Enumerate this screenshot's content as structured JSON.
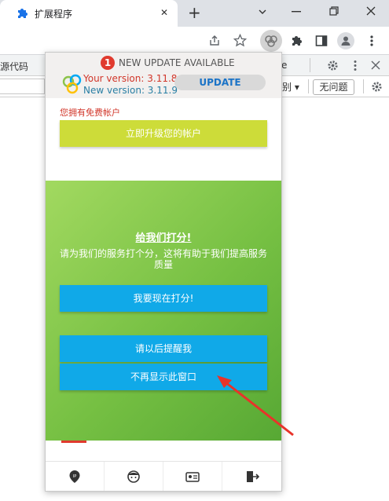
{
  "browser": {
    "tab_title": "扩展程序",
    "new_tab_symbol": "+",
    "close_symbol": "✕"
  },
  "devtools": {
    "source_label": "源代码",
    "partial_e": "e",
    "partial_filter": "别 ▾",
    "no_issues": "无问题"
  },
  "popup": {
    "badge_count": "1",
    "update_title": "NEW UPDATE AVAILABLE",
    "your_version": "Your version: 3.11.8",
    "new_version": "New version: 3.11.9",
    "update_button": "UPDATE",
    "free_account_text": "您拥有免费帐户",
    "upgrade_button": "立即升级您的帐户",
    "rate_title": "给我们打分!",
    "rate_description": "请为我们的服务打个分，这将有助于我们提高服务质量",
    "rate_now_button": "我要现在打分!",
    "remind_later_button": "请以后提醒我",
    "dont_show_button": "不再显示此窗口",
    "colors": {
      "upgrade": "#cddc39",
      "rate_buttons": "#10a9e8",
      "version_red": "#d1362a",
      "version_blue": "#2a7fa4"
    }
  },
  "bottom_nav": [
    "ip-location-icon",
    "user-avatar-icon",
    "id-card-icon",
    "exit-icon"
  ]
}
